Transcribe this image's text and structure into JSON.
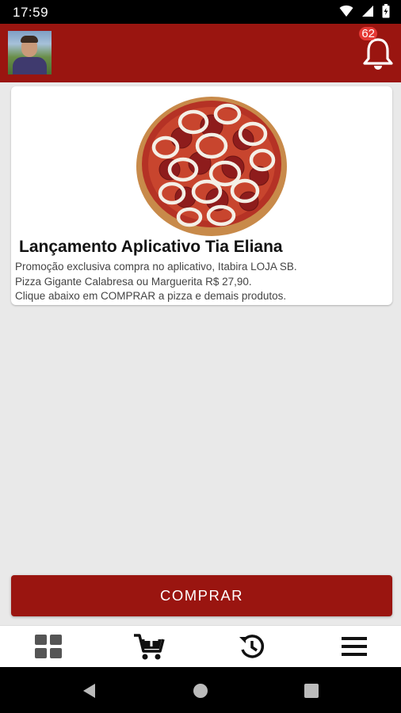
{
  "status_bar": {
    "time": "17:59"
  },
  "header": {
    "notification_count": "62"
  },
  "promo": {
    "title": "Lançamento Aplicativo Tia Eliana",
    "description_lines": [
      "Promoção exclusiva compra no aplicativo, Itabira LOJA SB.",
      "Pizza Gigante Calabresa ou Marguerita R$ 27,90.",
      "Clique abaixo em COMPRAR a pizza e demais produtos."
    ]
  },
  "actions": {
    "buy_label": "COMPRAR"
  },
  "bottom_nav": {
    "items": [
      {
        "icon": "grid-icon"
      },
      {
        "icon": "add-to-cart-icon"
      },
      {
        "icon": "history-icon"
      },
      {
        "icon": "menu-icon"
      }
    ]
  },
  "colors": {
    "primary": "#9a1510",
    "badge": "#e53935",
    "background": "#e9e9e9"
  }
}
